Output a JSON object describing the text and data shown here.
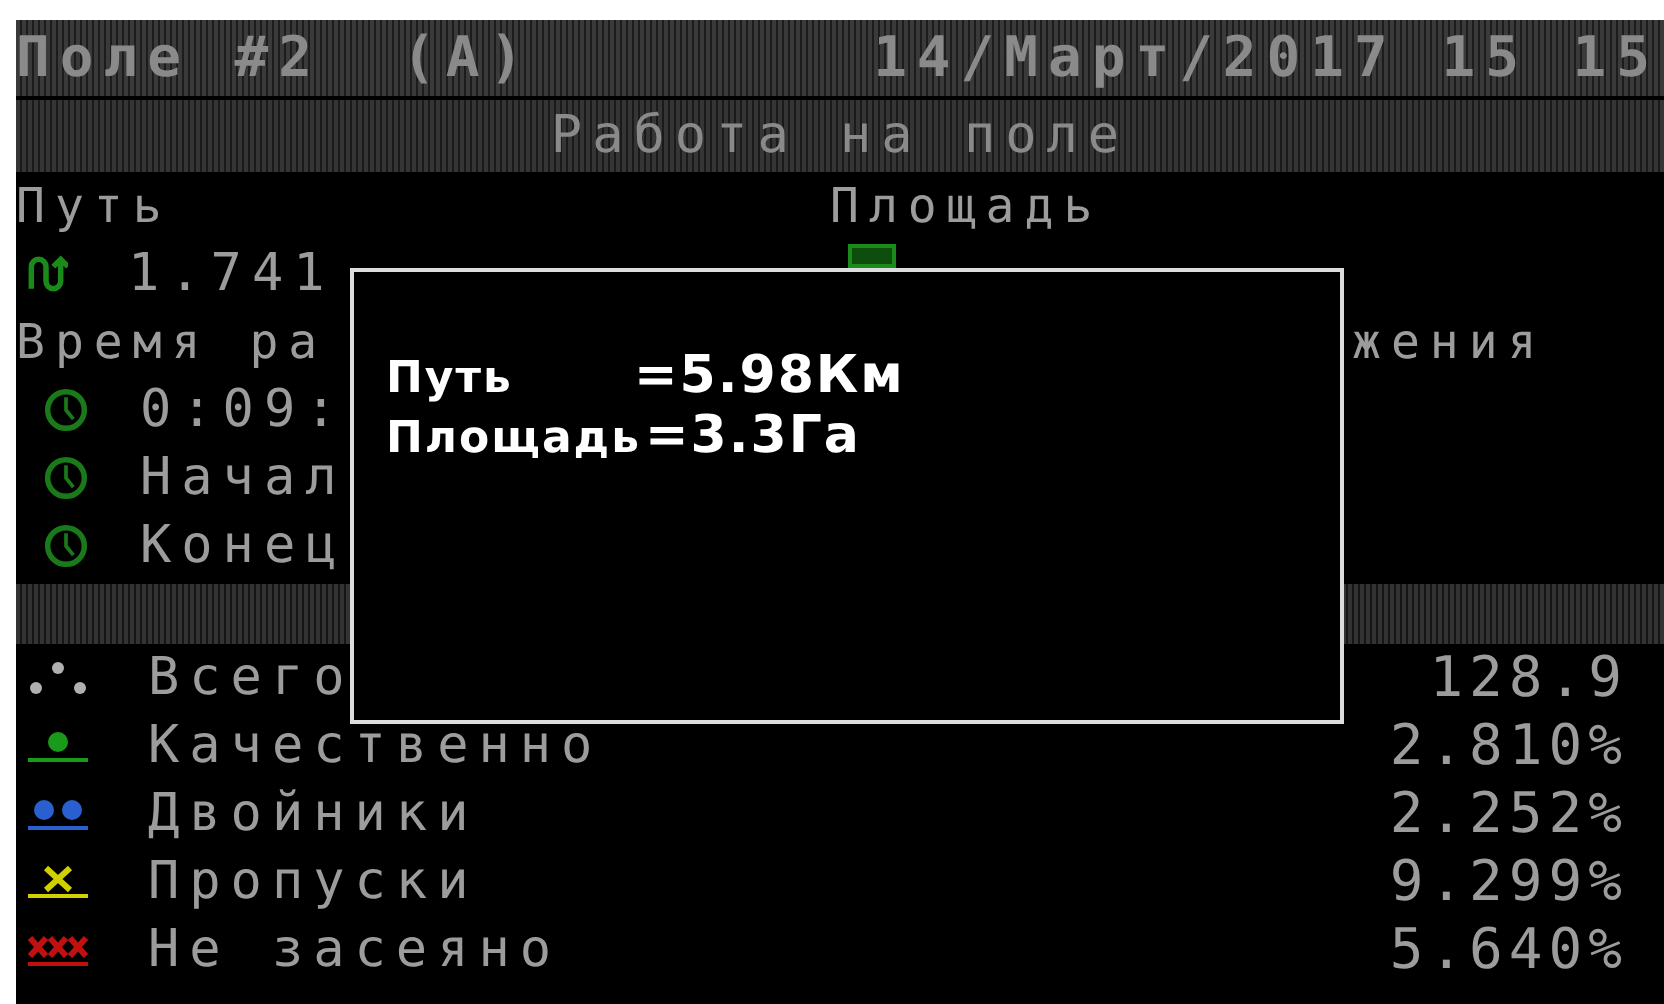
{
  "header": {
    "field": "Поле #2",
    "mode": "(A)",
    "datetime": "14/Март/2017 15 15"
  },
  "screen_title": "Работа на поле",
  "path": {
    "label": "Путь",
    "value": "1.741"
  },
  "area": {
    "label": "Площадь"
  },
  "time": {
    "label": "Время ра",
    "label_tail": "жения",
    "rows": [
      "0:09:",
      "Начал",
      "Конец"
    ]
  },
  "stats": [
    {
      "kind": "all",
      "color": "#b0b0b0",
      "label": "Всего",
      "value": "128.9"
    },
    {
      "kind": "good",
      "color": "#1a9a1a",
      "label": "Качественно",
      "value": "2.810%"
    },
    {
      "kind": "double",
      "color": "#2a5fd0",
      "label": "Двойники",
      "value": "2.252%"
    },
    {
      "kind": "skip",
      "color": "#d0d000",
      "label": "Пропуски",
      "value": "9.299%"
    },
    {
      "kind": "none",
      "color": "#c01010",
      "label": "Не засеяно",
      "value": "5.640%"
    }
  ],
  "popup": {
    "lines": [
      {
        "label": "Путь",
        "value": "=5.98Км"
      },
      {
        "label": "Площадь",
        "value": "=3.3Га"
      }
    ]
  }
}
